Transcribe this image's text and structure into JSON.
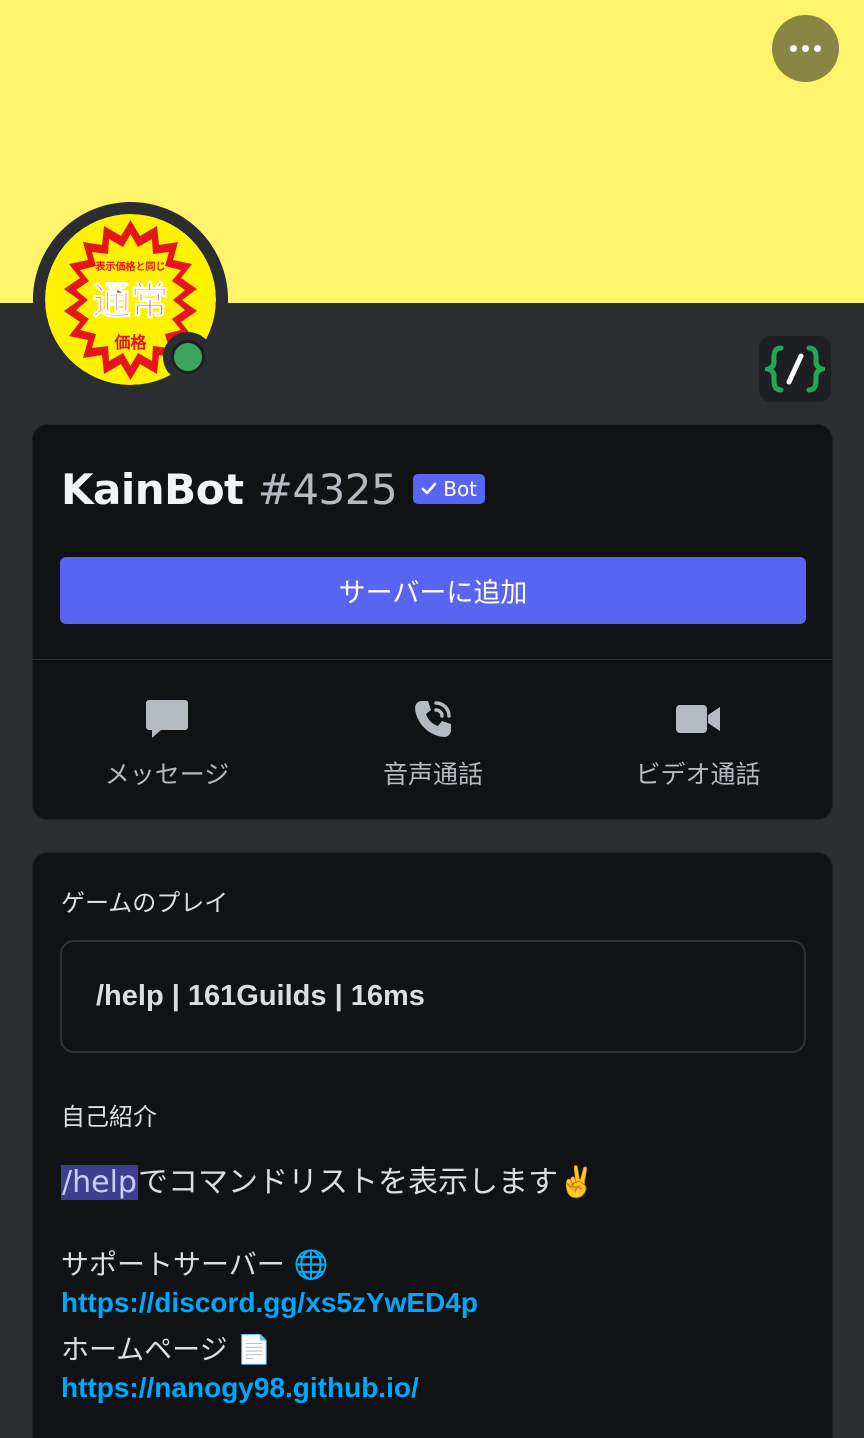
{
  "profile": {
    "username": "KainBot",
    "discriminator": "#4325",
    "bot_tag": "Bot",
    "add_server_label": "サーバーに追加",
    "avatar_text": {
      "top": "表示価格と同じ",
      "middle": "通常",
      "bottom": "価格"
    }
  },
  "actions": {
    "message": "メッセージ",
    "voice": "音声通話",
    "video": "ビデオ通話"
  },
  "playing": {
    "title": "ゲームのプレイ",
    "activity": "/help | 161Guilds | 16ms"
  },
  "about": {
    "title": "自己紹介",
    "command": "/help",
    "line1_rest": "でコマンドリストを表示します✌️",
    "support_label": "サポートサーバー 🌐",
    "support_link": "https://discord.gg/xs5zYwED4p",
    "home_label": "ホームページ 📄",
    "home_link": "https://nanogy98.github.io/"
  },
  "colors": {
    "banner": "#fef36a",
    "accent": "#5865f2",
    "online": "#3ba55c",
    "link": "#00a8fc"
  },
  "icons": [
    "more-icon",
    "slash-commands-icon",
    "verified-check-icon",
    "message-icon",
    "voice-call-icon",
    "video-call-icon"
  ]
}
